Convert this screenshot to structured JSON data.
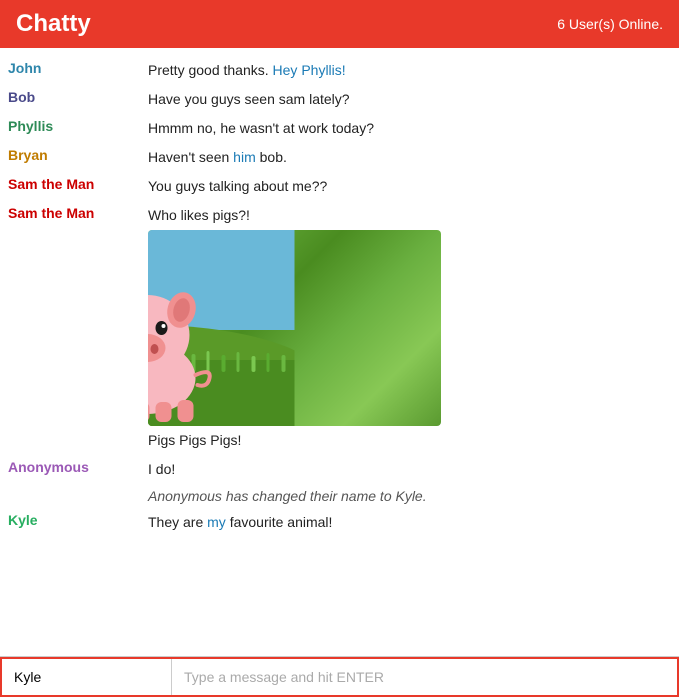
{
  "header": {
    "title": "Chatty",
    "online_label": "6 User(s) Online."
  },
  "messages": [
    {
      "id": 1,
      "name": "John",
      "name_class": "name-john",
      "message": "Pretty good thanks. Hey Phyllis!",
      "highlight": "Phyllis"
    },
    {
      "id": 2,
      "name": "Bob",
      "name_class": "name-bob",
      "message": "Have you guys seen sam lately?"
    },
    {
      "id": 3,
      "name": "Phyllis",
      "name_class": "name-phyllis",
      "message": "Hmmm no, he wasn't at work today?"
    },
    {
      "id": 4,
      "name": "Bryan",
      "name_class": "name-bryan",
      "message": "Haven't seen him bob."
    },
    {
      "id": 5,
      "name": "Sam the Man",
      "name_class": "name-sam",
      "message": "You guys talking about me??"
    },
    {
      "id": 6,
      "name": "Sam the Man",
      "name_class": "name-sam",
      "message_parts": [
        "Who likes pigs?!",
        "image",
        "Pigs Pigs Pigs!"
      ]
    },
    {
      "id": 7,
      "name": "Anonymous",
      "name_class": "name-anonymous",
      "message": "I do!"
    },
    {
      "id": 8,
      "system": true,
      "message": "Anonymous has changed their name to Kyle."
    },
    {
      "id": 9,
      "name": "Kyle",
      "name_class": "name-kyle",
      "message": "They are my favourite animal!"
    }
  ],
  "footer": {
    "username_value": "Kyle",
    "message_placeholder": "Type a message and hit ENTER"
  }
}
